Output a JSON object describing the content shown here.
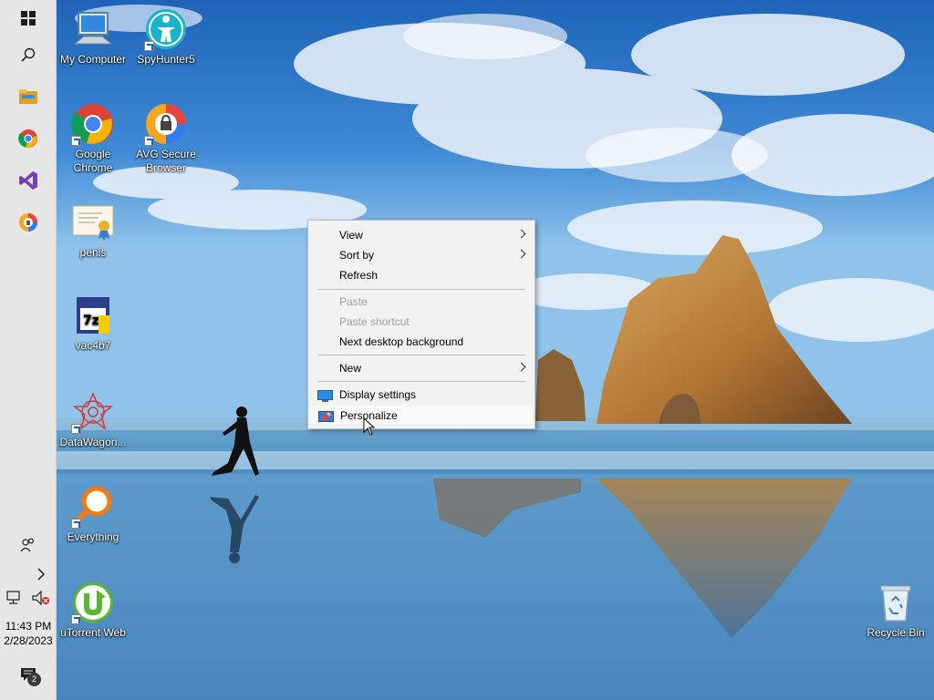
{
  "taskbar": {
    "icons": [
      "windows-start-icon",
      "search-icon",
      "file-explorer-icon",
      "chrome-icon",
      "visual-studio-icon",
      "avg-browser-icon",
      "people-icon",
      "chevron-right-icon",
      "network-icon",
      "volume-muted-icon",
      "action-center-icon"
    ],
    "clock_time": "11:43 PM",
    "clock_date": "2/28/2023",
    "notification_count": "2"
  },
  "desktop": {
    "icons": [
      {
        "label": "My Computer",
        "icon": "computer-icon"
      },
      {
        "label": "SpyHunter5",
        "icon": "spyhunter-icon"
      },
      {
        "label": "Google Chrome",
        "icon": "chrome-icon"
      },
      {
        "label": "AVG Secure Browser",
        "icon": "avg-browser-icon"
      },
      {
        "label": "penis",
        "icon": "certificate-file-icon"
      },
      {
        "label": "vac4b7",
        "icon": "7z-archive-icon"
      },
      {
        "label": "DataWagon...",
        "icon": "datawagon-icon"
      },
      {
        "label": "Everything",
        "icon": "everything-search-icon"
      },
      {
        "label": "uTorrent Web",
        "icon": "utorrent-icon"
      },
      {
        "label": "Recycle Bin",
        "icon": "recycle-bin-icon"
      }
    ]
  },
  "context_menu": {
    "items": [
      {
        "label": "View",
        "submenu": true,
        "enabled": true
      },
      {
        "label": "Sort by",
        "submenu": true,
        "enabled": true
      },
      {
        "label": "Refresh",
        "submenu": false,
        "enabled": true
      },
      {
        "label": "Paste",
        "submenu": false,
        "enabled": false
      },
      {
        "label": "Paste shortcut",
        "submenu": false,
        "enabled": false
      },
      {
        "label": "Next desktop background",
        "submenu": false,
        "enabled": true
      },
      {
        "label": "New",
        "submenu": true,
        "enabled": true
      },
      {
        "label": "Display settings",
        "submenu": false,
        "enabled": true,
        "icon": "display-settings-icon"
      },
      {
        "label": "Personalize",
        "submenu": false,
        "enabled": true,
        "icon": "personalize-icon",
        "hovered": true
      }
    ]
  },
  "colors": {
    "taskbar_bg": "#e6e6e6",
    "menu_bg": "#f2f2f2",
    "disabled_text": "#a0a0a0"
  }
}
